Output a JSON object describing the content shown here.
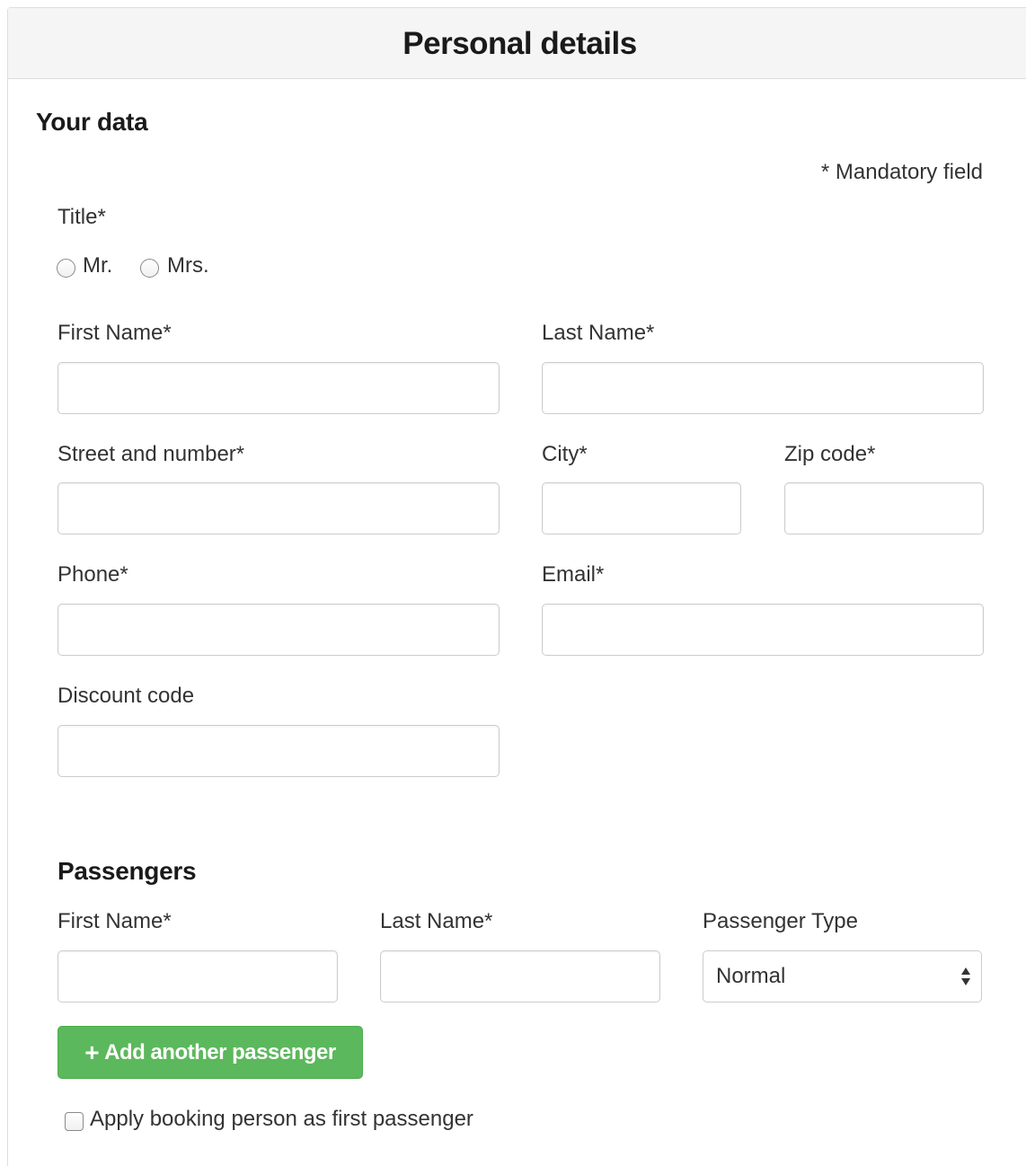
{
  "panel": {
    "title": "Personal details"
  },
  "your_data": {
    "heading": "Your data",
    "mandatory_note": "* Mandatory field",
    "title_label": "Title*",
    "title_options": [
      "Mr.",
      "Mrs."
    ],
    "first_name_label": "First Name*",
    "last_name_label": "Last Name*",
    "street_label": "Street and number*",
    "city_label": "City*",
    "zip_label": "Zip code*",
    "phone_label": "Phone*",
    "email_label": "Email*",
    "discount_label": "Discount code"
  },
  "passengers": {
    "heading": "Passengers",
    "first_name_label": "First Name*",
    "last_name_label": "Last Name*",
    "type_label": "Passenger Type",
    "type_selected": "Normal",
    "add_button_label": "Add another passenger",
    "apply_checkbox_label": "Apply booking person as first passenger"
  },
  "colors": {
    "button_green": "#5cb85c",
    "header_bg": "#f5f5f5",
    "border": "#cccccc"
  }
}
